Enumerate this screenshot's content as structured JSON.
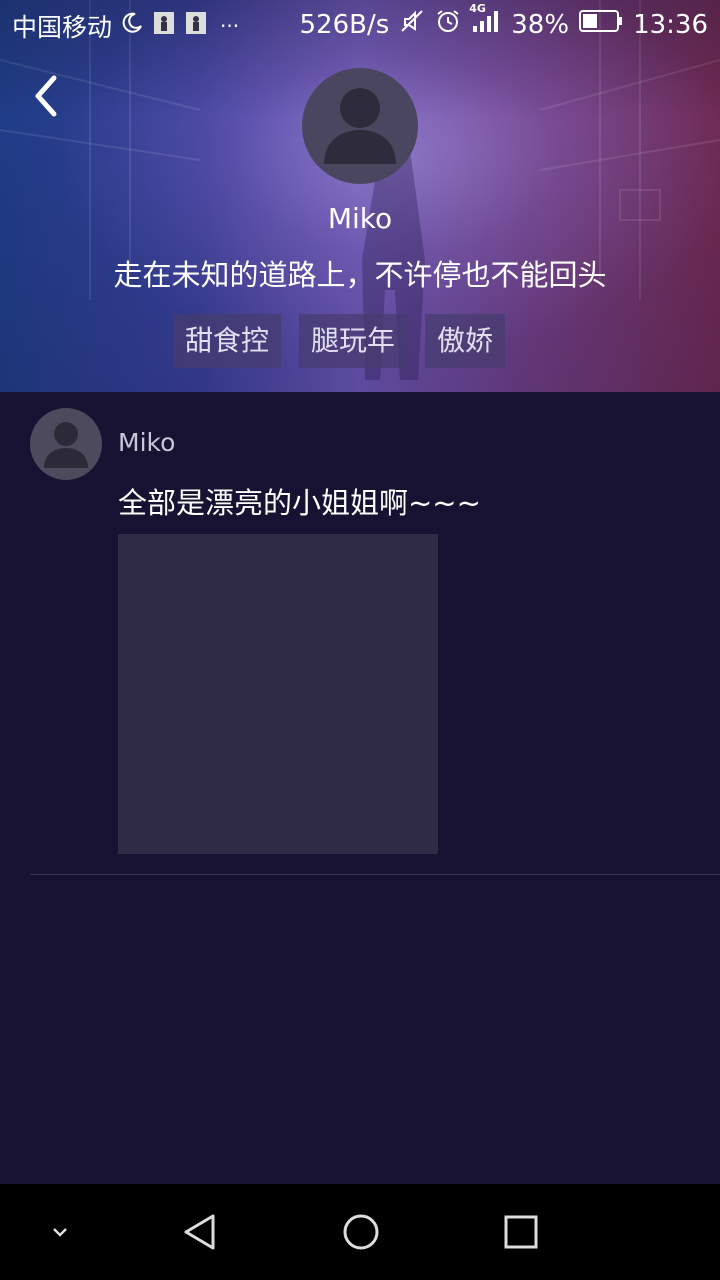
{
  "status_bar": {
    "carrier": "中国移动",
    "more": "···",
    "net_speed": "526B/s",
    "network_type": "4G",
    "battery": "38%",
    "time": "13:36"
  },
  "profile": {
    "name": "Miko",
    "bio": "走在未知的道路上，不许停也不能回头",
    "tags": [
      "甜食控",
      "腿玩年",
      "傲娇"
    ]
  },
  "post": {
    "author": "Miko",
    "text": "全部是漂亮的小姐姐啊~~~"
  },
  "icons": {
    "back": "chevron-left-icon",
    "nav_down": "chevron-down-icon",
    "nav_back": "triangle-back-icon",
    "nav_home": "circle-home-icon",
    "nav_recent": "square-recent-icon"
  },
  "colors": {
    "background": "#181232",
    "tag_bg": "#463c6e",
    "image_placeholder": "#302b45"
  }
}
